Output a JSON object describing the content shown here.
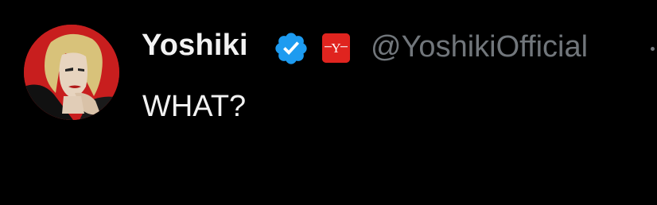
{
  "post": {
    "author_name": "Yoshiki",
    "handle": "@YoshikiOfficial",
    "text": "WHAT?",
    "verified_icon": "verified-badge-icon",
    "affiliate_icon": "affiliate-badge-icon",
    "affiliate_letter": "Y"
  },
  "colors": {
    "background": "#000000",
    "name": "#f2f2f2",
    "handle": "#71767b",
    "verified": "#1d9bf0",
    "affiliate": "#e0241f"
  }
}
